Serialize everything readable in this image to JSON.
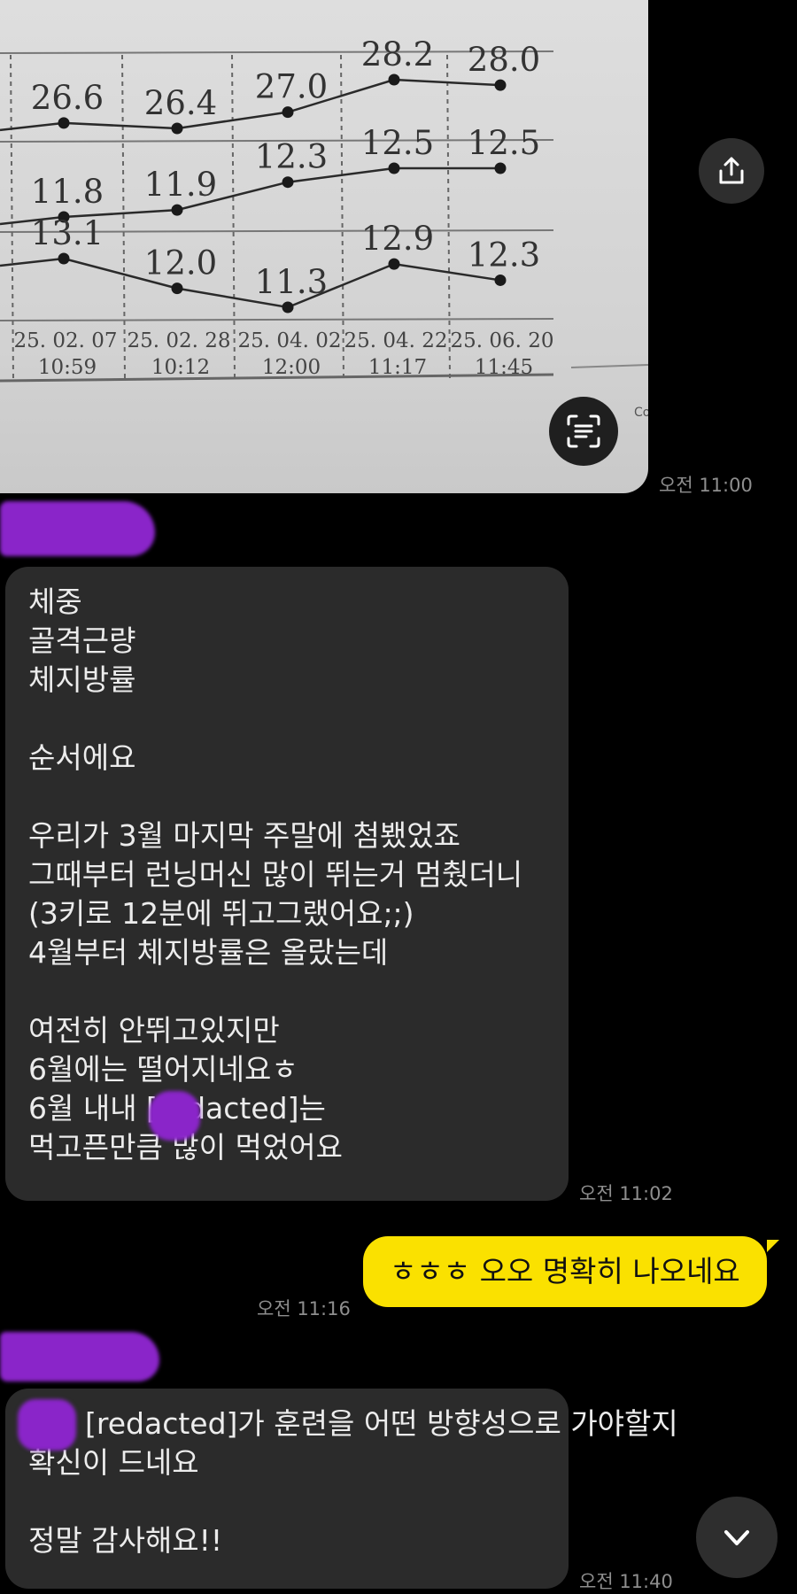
{
  "photo": {
    "rows": [
      {
        "values": [
          "26.6",
          "26.4",
          "27.0",
          "28.2",
          "28.0"
        ]
      },
      {
        "values": [
          "11.8",
          "11.9",
          "12.3",
          "12.5",
          "12.5"
        ]
      },
      {
        "values": [
          "13.1",
          "12.0",
          "11.3",
          "12.9",
          "12.3"
        ]
      }
    ],
    "dates": [
      "25. 02. 07",
      "25. 02. 28",
      "25. 04. 02",
      "25. 04. 22",
      "25. 06. 20"
    ],
    "times": [
      "10:59",
      "10:12",
      "12:00",
      "11:17",
      "11:45"
    ],
    "edge_text": "Co"
  },
  "messages": [
    {
      "sender": "other",
      "time": "오전 11:00",
      "type": "image"
    },
    {
      "sender": "other",
      "time": "오전 11:02",
      "lines": [
        "체중",
        "골격근량",
        "체지방률",
        "",
        "순서에요",
        "",
        "우리가 3월 마지막 주말에 첨뵀었죠",
        "그때부터 런닝머신 많이 뛰는거 멈췄더니",
        "(3키로 12분에 뛰고그랬어요;;)",
        "4월부터 체지방률은 올랐는데",
        "",
        "여전히 안뛰고있지만",
        "6월에는 떨어지네요ㅎ",
        "6월 내내 [redacted]는",
        "먹고픈만큼 많이 먹었어요"
      ]
    },
    {
      "sender": "me",
      "time": "오전 11:16",
      "text": "ㅎㅎㅎ 오오 명확히 나오네요"
    },
    {
      "sender": "other",
      "time": "오전 11:40",
      "lines": [
        "[redacted]가 훈련을 어떤 방향성으로 가야할지",
        "확신이 드네요",
        "",
        "정말 감사해요!!"
      ]
    }
  ],
  "icons": {
    "share": "share-upload-icon",
    "text_scan": "text-scan-icon",
    "scroll_down": "chevron-down-icon"
  },
  "colors": {
    "background": "#000000",
    "other_bubble": "#2b2b2b",
    "my_bubble": "#fae100",
    "timestamp": "#8e8e8e",
    "redaction": "#8a25c9"
  }
}
